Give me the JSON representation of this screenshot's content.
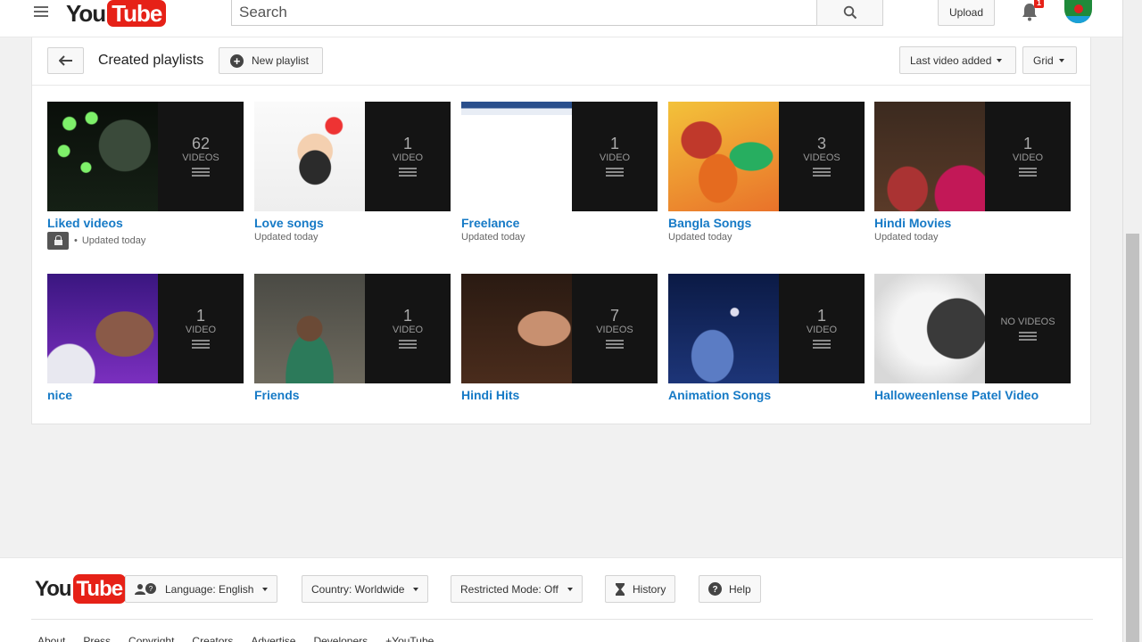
{
  "masthead": {
    "logo_you": "You",
    "logo_tube": "Tube",
    "search_placeholder": "Search",
    "upload_label": "Upload",
    "notification_count": "1"
  },
  "header": {
    "title": "Created playlists",
    "new_playlist_label": "New playlist",
    "sort_label": "Last video added",
    "view_label": "Grid"
  },
  "playlists": [
    {
      "title": "Liked videos",
      "count": "62",
      "unit": "VIDEOS",
      "meta": "Updated today",
      "private": true
    },
    {
      "title": "Love songs",
      "count": "1",
      "unit": "VIDEO",
      "meta": "Updated today"
    },
    {
      "title": "Freelance",
      "count": "1",
      "unit": "VIDEO",
      "meta": "Updated today"
    },
    {
      "title": "Bangla Songs",
      "count": "3",
      "unit": "VIDEOS",
      "meta": "Updated today"
    },
    {
      "title": "Hindi Movies",
      "count": "1",
      "unit": "VIDEO",
      "meta": "Updated today"
    },
    {
      "title": "nice",
      "count": "1",
      "unit": "VIDEO"
    },
    {
      "title": "Friends",
      "count": "1",
      "unit": "VIDEO"
    },
    {
      "title": "Hindi Hits",
      "count": "7",
      "unit": "VIDEOS"
    },
    {
      "title": "Animation Songs",
      "count": "1",
      "unit": "VIDEO"
    },
    {
      "title": "Halloweenlense Patel Video",
      "count": "",
      "unit": "NO VIDEOS"
    }
  ],
  "footer": {
    "logo_you": "You",
    "logo_tube": "Tube",
    "language_label": "Language: English",
    "country_label": "Country: Worldwide",
    "restricted_label": "Restricted Mode: Off",
    "history_label": "History",
    "help_label": "Help",
    "links": [
      "About",
      "Press",
      "Copyright",
      "Creators",
      "Advertise",
      "Developers",
      "+YouTube"
    ]
  },
  "colors": {
    "brand_red": "#e62117",
    "link_blue": "#167ac6"
  }
}
